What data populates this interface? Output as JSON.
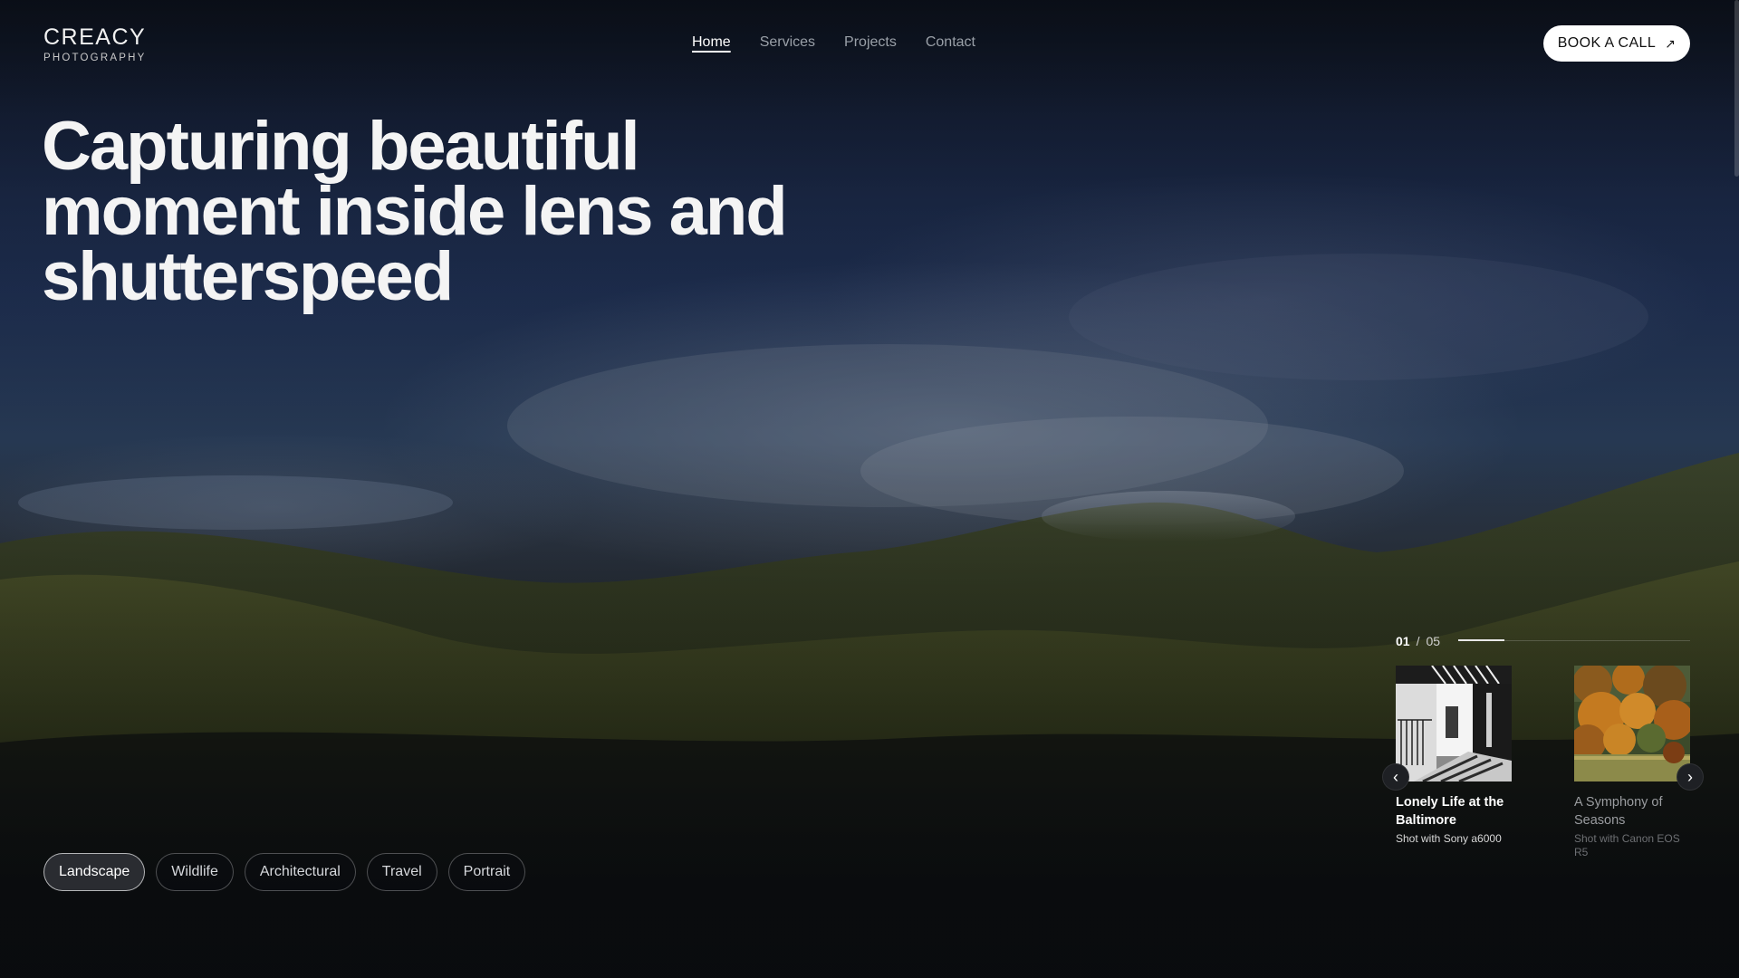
{
  "brand": {
    "name": "CREACY",
    "tagline": "PHOTOGRAPHY"
  },
  "nav": {
    "items": [
      {
        "label": "Home",
        "active": true
      },
      {
        "label": "Services",
        "active": false
      },
      {
        "label": "Projects",
        "active": false
      },
      {
        "label": "Contact",
        "active": false
      }
    ]
  },
  "cta": {
    "label": "BOOK A CALL",
    "icon": "arrow-up-right-icon"
  },
  "hero": {
    "headline_lines": [
      "Capturing beautiful",
      "moment inside lens and",
      "shutterspeed"
    ]
  },
  "categories": {
    "items": [
      {
        "label": "Landscape",
        "active": true
      },
      {
        "label": "Wildlife",
        "active": false
      },
      {
        "label": "Architectural",
        "active": false
      },
      {
        "label": "Travel",
        "active": false
      },
      {
        "label": "Portrait",
        "active": false
      }
    ]
  },
  "slider": {
    "current": "01",
    "separator": "/",
    "total": "05",
    "progress": 0.2,
    "prev_icon": "chevron-left-icon",
    "next_icon": "chevron-right-icon",
    "cards": [
      {
        "title": "Lonely Life at the Baltimore",
        "subtitle": "Shot with Sony a6000"
      },
      {
        "title": "A Symphony of Seasons",
        "subtitle": "Shot with Canon EOS R5"
      }
    ]
  },
  "colors": {
    "background": "#0b0c10",
    "accent": "#ffffff",
    "nav_inactive": "#9aa0a8"
  }
}
